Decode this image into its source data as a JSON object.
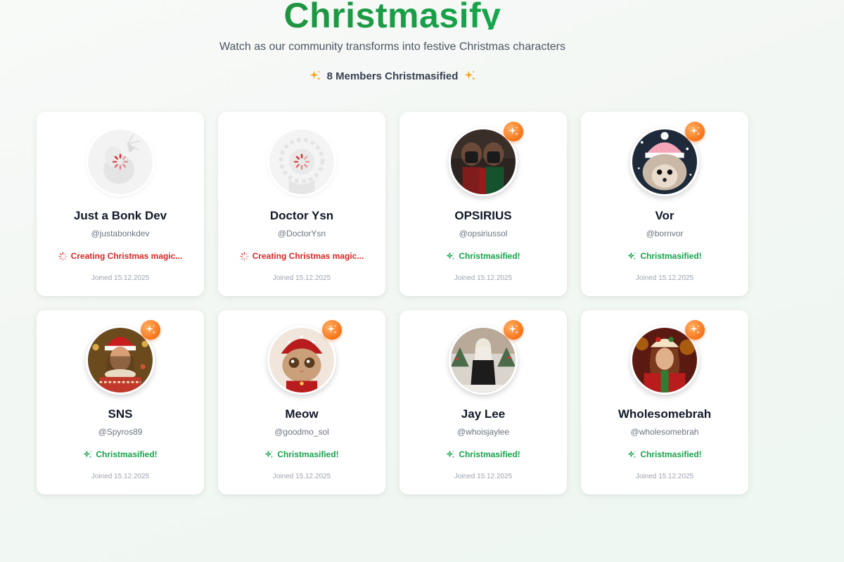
{
  "header": {
    "title": "Christmasify",
    "subtitle": "Watch as our community transforms into festive Christmas characters",
    "member_count": "8 Members Christmasified"
  },
  "colors": {
    "accent_green": "#16a34a",
    "loading_red": "#dc2626",
    "badge_orange": "#f97316"
  },
  "members": [
    {
      "name": "Just a Bonk Dev",
      "handle": "@justabonkdev",
      "status": "Creating Christmas magic...",
      "joined": "Joined 15.12.2025"
    },
    {
      "name": "Doctor Ysn",
      "handle": "@DoctorYsn",
      "status": "Creating Christmas magic...",
      "joined": "Joined 15.12.2025"
    },
    {
      "name": "OPSIRIUS",
      "handle": "@opsiriussol",
      "status": "Christmasified!",
      "joined": "Joined 15.12.2025"
    },
    {
      "name": "Vor",
      "handle": "@bornvor",
      "status": "Christmasified!",
      "joined": "Joined 15.12.2025"
    },
    {
      "name": "SNS",
      "handle": "@Spyros89",
      "status": "Christmasified!",
      "joined": "Joined 15.12.2025"
    },
    {
      "name": "Meow",
      "handle": "@goodmo_sol",
      "status": "Christmasified!",
      "joined": "Joined 15.12.2025"
    },
    {
      "name": "Jay Lee",
      "handle": "@whoisjaylee",
      "status": "Christmasified!",
      "joined": "Joined 15.12.2025"
    },
    {
      "name": "Wholesomebrah",
      "handle": "@wholesomebrah",
      "status": "Christmasified!",
      "joined": "Joined 15.12.2025"
    }
  ]
}
